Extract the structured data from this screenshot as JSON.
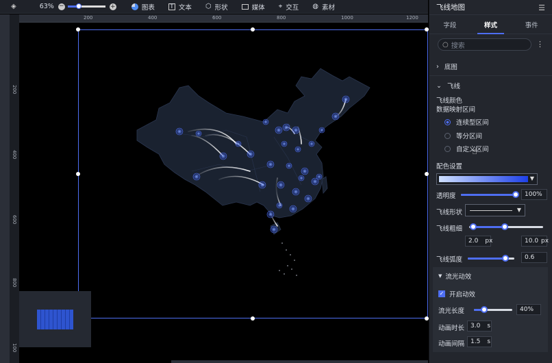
{
  "toolbar": {
    "zoom": "63%",
    "items": [
      "图表",
      "文本",
      "形状",
      "媒体",
      "交互",
      "素材"
    ]
  },
  "ruler": {
    "h_ticks": [
      "200",
      "400",
      "600",
      "800",
      "1000",
      "1200"
    ],
    "v_ticks": [
      "200",
      "400",
      "600",
      "800",
      "100"
    ]
  },
  "panel": {
    "title": "飞线地图",
    "tabs": [
      "字段",
      "样式",
      "事件"
    ],
    "active_tab": "样式",
    "search_placeholder": "搜索",
    "sections": {
      "base": "底图",
      "flyline": "飞线"
    },
    "color_label": "飞线颜色",
    "range_label": "数据映射区间",
    "range_options": [
      "连续型区间",
      "等分区间",
      "自定义区间"
    ],
    "palette_label": "配色设置",
    "opacity_label": "透明度",
    "opacity_value": "100%",
    "shape_label": "飞线形状",
    "width_label": "飞线粗细",
    "width_min": "2.0",
    "width_max": "10.0",
    "width_unit": "px",
    "arc_label": "飞线弧度",
    "arc_value": "0.6",
    "flow": {
      "title": "流光动效",
      "enable_label": "开启动效",
      "length_label": "流光长度",
      "length_value": "40%",
      "duration_label": "动画时长",
      "duration_value": "3.0",
      "interval_label": "动画间隔",
      "interval_value": "1.5",
      "unit": "s"
    }
  },
  "colors": {
    "accent": "#4e6ef2",
    "panel_bg": "#23262d",
    "map_fill": "#1a2230"
  }
}
